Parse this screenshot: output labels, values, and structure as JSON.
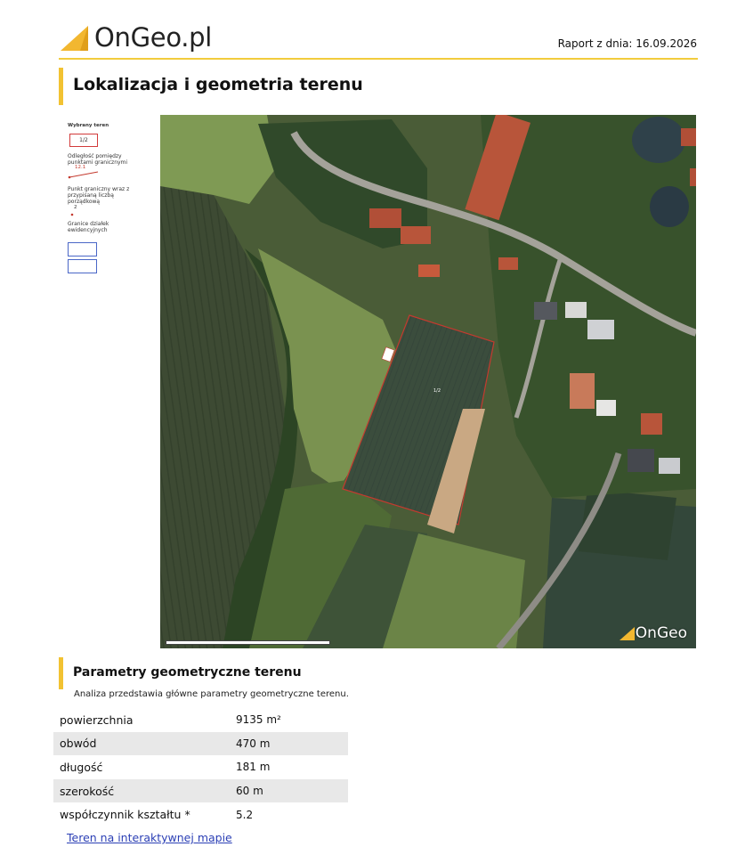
{
  "header": {
    "brand": "OnGeo.pl",
    "report_date": "Raport z dnia: 16.09.2026"
  },
  "section_location": {
    "title": "Lokalizacja i geometria terenu"
  },
  "legend": {
    "selected_area_title": "Wybrany teren",
    "selected_area_label": "1/2",
    "distance_title": "Odległość pomiędzy punktami granicznymi",
    "distance_value": "12.1",
    "point_title": "Punkt graniczny wraz z przypisaną liczbą porządkową",
    "point_number": "2",
    "parcel_borders_title": "Granice działek ewidencyjnych"
  },
  "map": {
    "watermark": "OnGeo",
    "parcel_label": "1/2",
    "edge_label_left": "12.1",
    "colors": {
      "field_dark": "#3a4a35",
      "grass": "#6f8b4a",
      "trees": "#2f4a24",
      "roof_red": "#b8553a",
      "road": "#9a9a94",
      "parcel_border": "#c43a2f",
      "water": "#2a3a44"
    }
  },
  "section_params": {
    "title": "Parametry geometryczne terenu",
    "description": "Analiza przedstawia główne parametry geometryczne terenu.",
    "rows": [
      {
        "label": "powierzchnia",
        "value": "9135 m²"
      },
      {
        "label": "obwód",
        "value": "470 m"
      },
      {
        "label": "długość",
        "value": "181 m"
      },
      {
        "label": "szerokość",
        "value": "60 m"
      },
      {
        "label": "współczynnik kształtu *",
        "value": "5.2"
      }
    ],
    "link_text": "Teren na interaktywnej mapie"
  },
  "colors": {
    "accent": "#f2c232",
    "link": "#2b3fb5"
  }
}
